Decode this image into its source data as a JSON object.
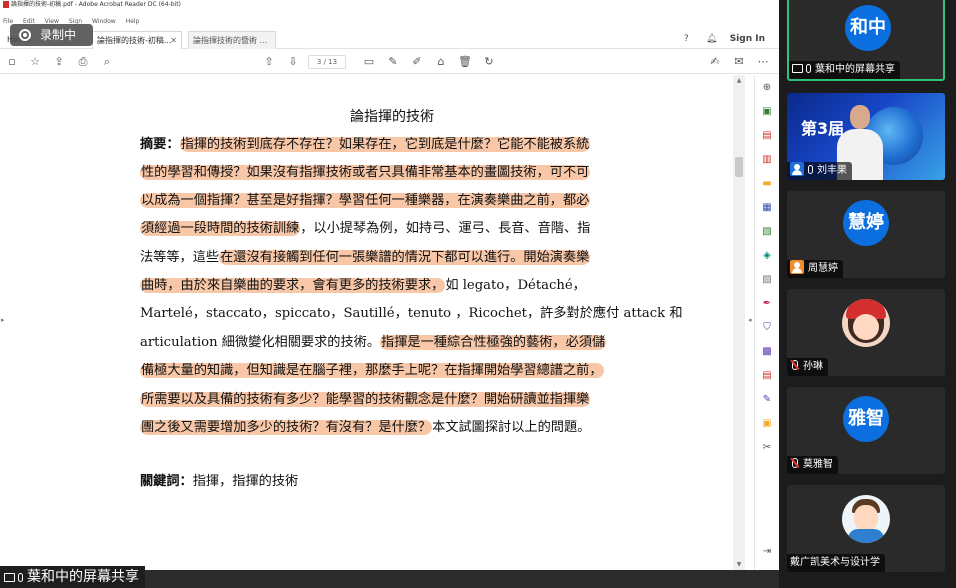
{
  "window": {
    "title": "論指揮的技術-初稿.pdf - Adobe Acrobat Reader DC (64-bit)",
    "menu": [
      "File",
      "Edit",
      "View",
      "Sign",
      "Window",
      "Help"
    ],
    "recording_badge": "录制中",
    "tabs": {
      "home": "Home",
      "doc1": "論指揮的技術-初稿...",
      "doc2": "論指揮技術的暨術 ..."
    },
    "sign_in": "Sign In",
    "page_indicator": "3 / 13"
  },
  "document": {
    "title": "論指揮的技術",
    "lines": [
      [
        {
          "t": "摘要：",
          "b": true
        },
        {
          "t": "指揮的技術到底存不存在？如果存在，它到底是什麼？它能不能被系統",
          "h": true
        }
      ],
      [
        {
          "t": "性的學習和傳授？如果沒有指揮技術或者只具備非常基本的畫圖技術，可不可",
          "h": true
        }
      ],
      [
        {
          "t": "以成為一個指揮？甚至是好指揮？學習任何一種樂器，在演奏樂曲之前，都必",
          "h": true
        }
      ],
      [
        {
          "t": "須經過一段時間的技術訓練",
          "h": true
        },
        {
          "t": "，以小提琴為例，如持弓、運弓、長音、音階、指"
        }
      ],
      [
        {
          "t": "法等等，這些"
        },
        {
          "t": "在還沒有接觸到任何一張樂譜的情況下都可以進行。開始演奏樂",
          "h": true
        }
      ],
      [
        {
          "t": "曲時，由於來自樂曲的要求，會有更多的技術要求，",
          "h": true
        },
        {
          "t": "如 legato，Détaché，"
        }
      ],
      [
        {
          "t": "Martelé，staccato，spiccato，Sautillé，tenuto ，Ricochet，許多對於應付 attack 和"
        }
      ],
      [
        {
          "t": "articulation 細微變化相關要求的技術。"
        },
        {
          "t": "指揮是一種綜合性極強的藝術，必須儲",
          "h": true
        }
      ],
      [
        {
          "t": "備極大量的知識，但知識是在腦子裡，那麼手上呢？在指揮開始學習總譜之前，",
          "h": true
        }
      ],
      [
        {
          "t": "所需要以及具備的技術有多少？能學習的技術觀念是什麼？開始研讀並指揮樂",
          "h": true
        }
      ],
      [
        {
          "t": "團之後又需要增加多少的技術？有沒有？是什麼？",
          "h": true
        },
        {
          "t": "本文試圖探討以上的問題。"
        }
      ]
    ],
    "keywords": [
      {
        "t": "關鍵詞：",
        "b": true
      },
      {
        "t": "指揮，指揮的技術"
      }
    ]
  },
  "share_bar": {
    "label": "葉和中的屏幕共享"
  },
  "participants": [
    {
      "avatar": "和中",
      "name": "葉和中的屏幕共享",
      "type": "circle",
      "active": true,
      "icon": "share"
    },
    {
      "name": "刘丰果",
      "type": "video",
      "slogan_big": "第3届",
      "icon": "person"
    },
    {
      "avatar": "慧婷",
      "name": "周慧婷",
      "type": "circle",
      "icon": "person-orange"
    },
    {
      "name": "孙琳",
      "type": "cartoon-red",
      "icon": "mic-off"
    },
    {
      "avatar": "雅智",
      "name": "莫雅智",
      "type": "circle",
      "icon": "mic-off"
    },
    {
      "name": "戴广凯美术与设计学",
      "type": "cartoon-blue",
      "icon": "none"
    }
  ],
  "colors": {
    "highlight": "#f7c7a8",
    "avatar_blue": "#0b6fe0",
    "active_border": "#2ec27e"
  }
}
